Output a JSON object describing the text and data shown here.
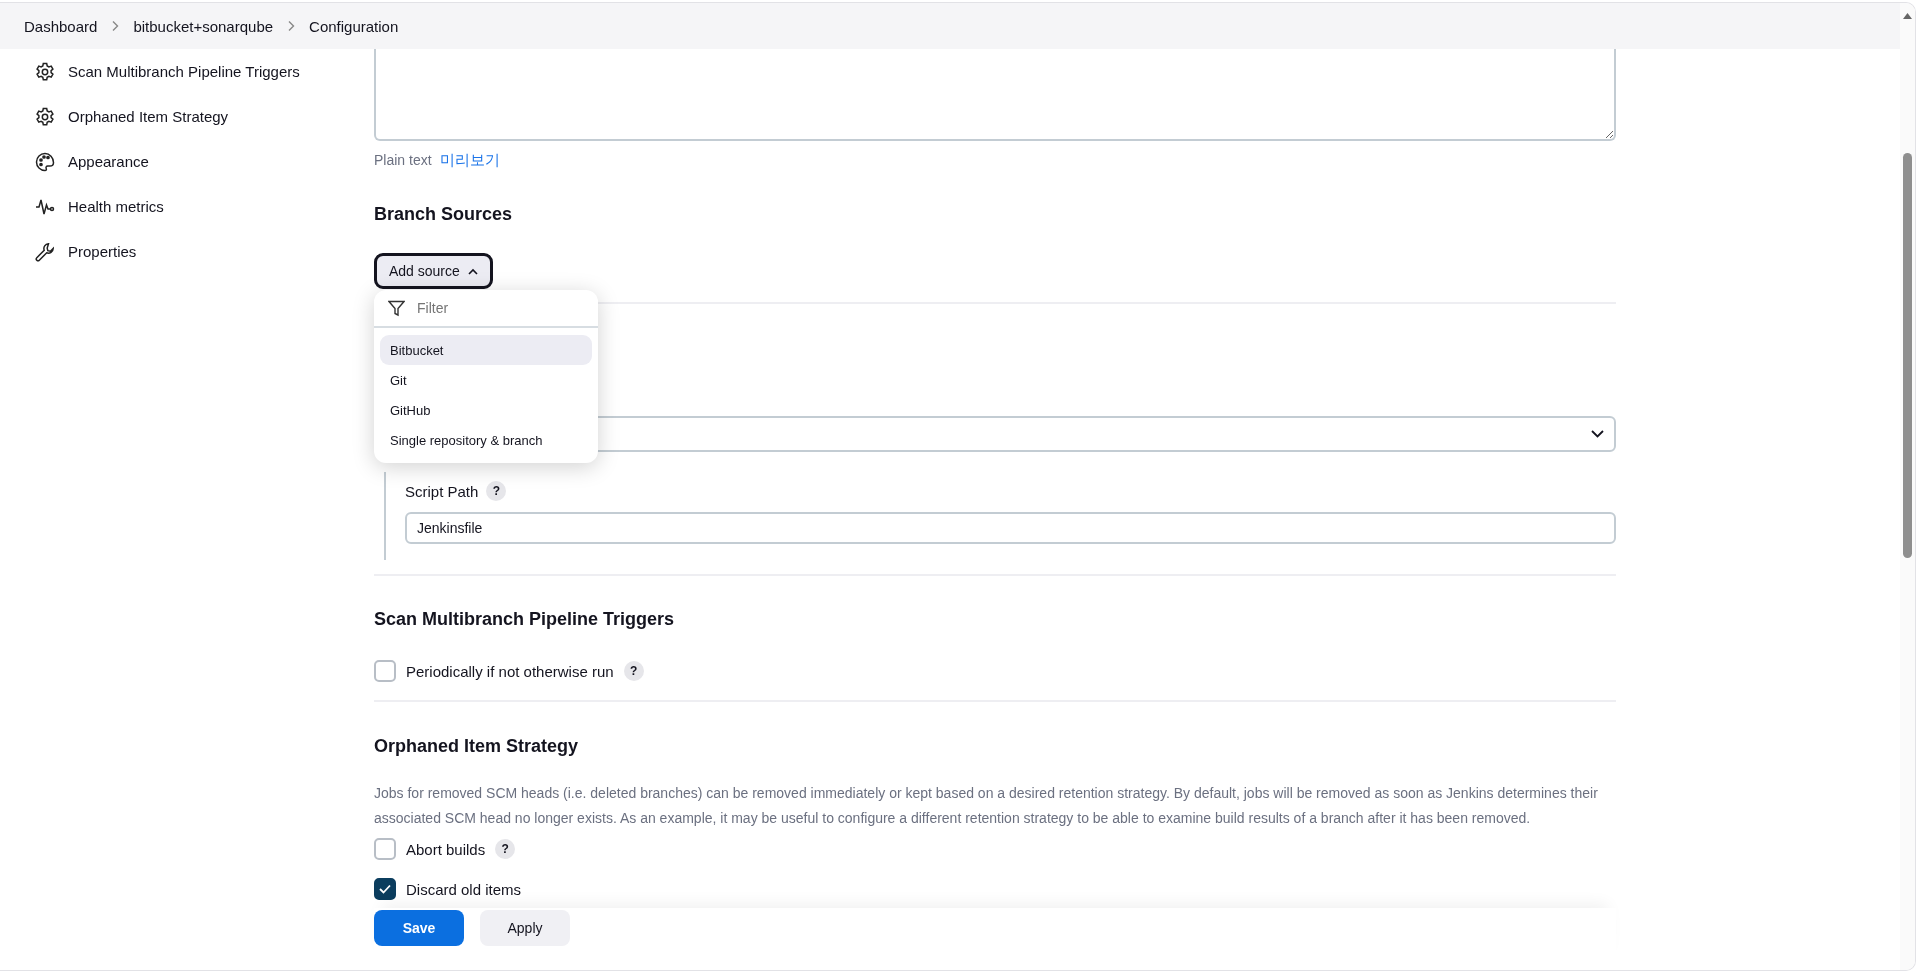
{
  "breadcrumbs": [
    {
      "label": "Dashboard"
    },
    {
      "label": "bitbucket+sonarqube"
    },
    {
      "label": "Configuration"
    }
  ],
  "sidebar": {
    "items": [
      {
        "label": "Scan Multibranch Pipeline Triggers"
      },
      {
        "label": "Orphaned Item Strategy"
      },
      {
        "label": "Appearance"
      },
      {
        "label": "Health metrics"
      },
      {
        "label": "Properties"
      }
    ]
  },
  "description": {
    "format_label": "Plain text",
    "preview_link": "미리보기"
  },
  "branch_sources": {
    "heading": "Branch Sources",
    "add_button": "Add source",
    "menu": {
      "filter_placeholder": "Filter",
      "items": [
        {
          "label": "Bitbucket",
          "selected": true
        },
        {
          "label": "Git",
          "selected": false
        },
        {
          "label": "GitHub",
          "selected": false
        },
        {
          "label": "Single repository & branch",
          "selected": false
        }
      ]
    },
    "script_path": {
      "label": "Script Path",
      "help": "?",
      "value": "Jenkinsfile"
    }
  },
  "scan_triggers": {
    "heading": "Scan Multibranch Pipeline Triggers",
    "options": [
      {
        "label": "Periodically if not otherwise run",
        "checked": false,
        "help": "?"
      }
    ]
  },
  "orphaned": {
    "heading": "Orphaned Item Strategy",
    "description": "Jobs for removed SCM heads (i.e. deleted branches) can be removed immediately or kept based on a desired retention strategy. By default, jobs will be removed as soon as Jenkins determines their associated SCM head no longer exists. As an example, it may be useful to configure a different retention strategy to be able to examine build results of a branch after it has been removed.",
    "options": [
      {
        "label": "Abort builds",
        "checked": false,
        "help": "?"
      },
      {
        "label": "Discard old items",
        "checked": true
      }
    ]
  },
  "buttons": [
    {
      "label": "Save",
      "kind": "primary"
    },
    {
      "label": "Apply",
      "kind": "secondary"
    }
  ]
}
